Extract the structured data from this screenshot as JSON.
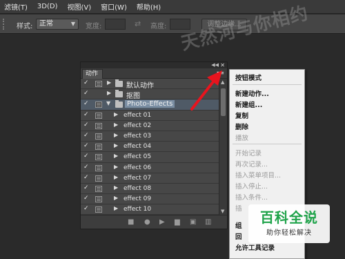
{
  "menubar": {
    "items": [
      "滤镜(T)",
      "3D(D)",
      "视图(V)",
      "窗口(W)",
      "帮助(H)"
    ]
  },
  "options_bar": {
    "style_label": "样式:",
    "style_value": "正常",
    "width_label": "宽度:",
    "height_label": "高度:",
    "refine_edge_button": "调整边缘..."
  },
  "watermark": "天然河与你相约",
  "actions_panel": {
    "tab_label": "动作",
    "sets": [
      {
        "name": "默认动作",
        "expanded": false
      },
      {
        "name": "抠图",
        "expanded": false
      },
      {
        "name": "Photo-Effects",
        "expanded": true
      }
    ],
    "actions": [
      "effect 01",
      "effect 02",
      "effect 03",
      "effect 04",
      "effect 05",
      "effect 06",
      "effect 07",
      "effect 08",
      "effect 09",
      "effect 10"
    ],
    "check_glyph": "✓"
  },
  "context_menu": {
    "items": [
      {
        "label": "按钮模式",
        "state": "normal"
      },
      {
        "label": "新建动作...",
        "state": "normal"
      },
      {
        "label": "新建组...",
        "state": "normal"
      },
      {
        "label": "复制",
        "state": "normal"
      },
      {
        "label": "删除",
        "state": "normal"
      },
      {
        "label": "播放",
        "state": "disabled"
      },
      {
        "label": "开始记录",
        "state": "disabled"
      },
      {
        "label": "再次记录...",
        "state": "disabled"
      },
      {
        "label": "插入菜单项目...",
        "state": "disabled"
      },
      {
        "label": "插入停止...",
        "state": "disabled"
      },
      {
        "label": "插入条件...",
        "state": "disabled"
      },
      {
        "label": "插",
        "state": "disabled"
      },
      {
        "label": "组",
        "state": "normal"
      },
      {
        "label": "回",
        "state": "normal"
      },
      {
        "label": "允许工具记录",
        "state": "normal"
      }
    ]
  },
  "baidu_badge": {
    "title": "百科全说",
    "subtitle": "助你轻松解决"
  },
  "colors": {
    "arrow": "#e8141e",
    "badge_green": "#1fa34a",
    "selection": "#7a8ea3"
  }
}
